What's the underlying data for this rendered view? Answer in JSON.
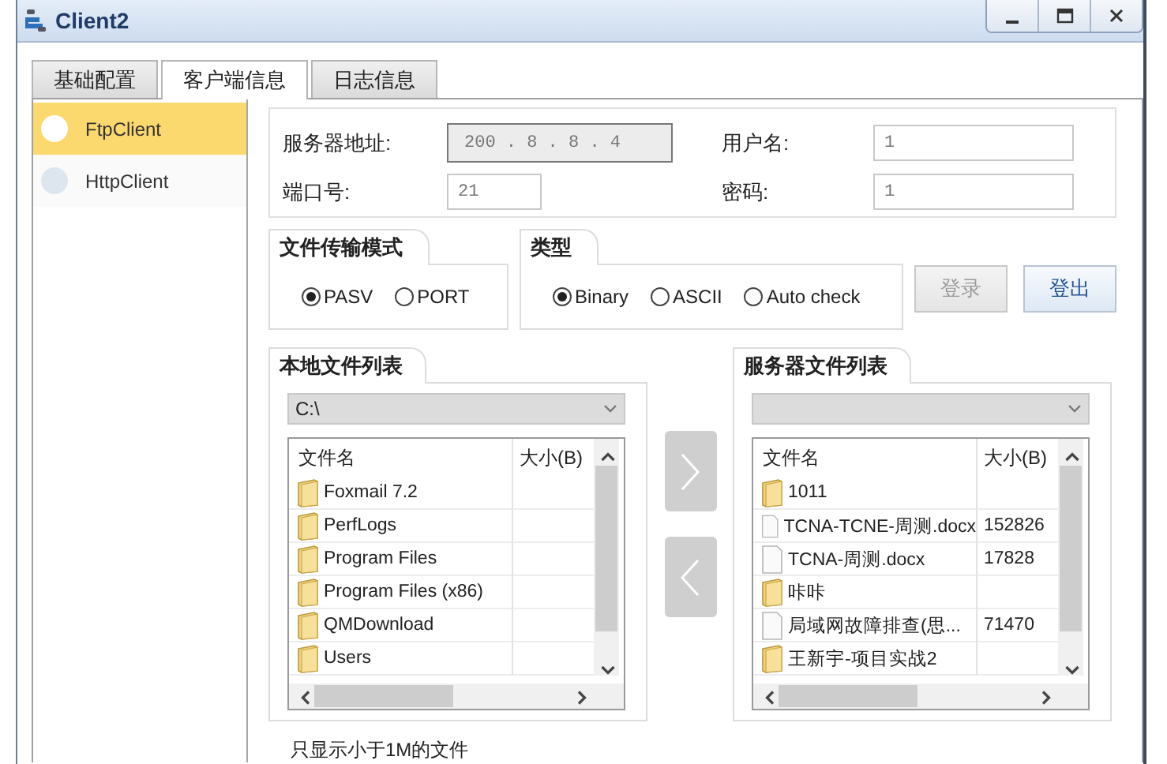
{
  "window": {
    "title": "Client2"
  },
  "tabs": [
    {
      "label": "基础配置",
      "selected": false
    },
    {
      "label": "客户端信息",
      "selected": true
    },
    {
      "label": "日志信息",
      "selected": false
    }
  ],
  "sidebar": {
    "items": [
      {
        "label": "FtpClient",
        "selected": true
      },
      {
        "label": "HttpClient",
        "selected": false
      }
    ]
  },
  "connection": {
    "server_address": {
      "label": "服务器地址:",
      "value": "200 . 8 . 8 . 4"
    },
    "username": {
      "label": "用户名:",
      "value": "1"
    },
    "port": {
      "label": "端口号:",
      "value": "21"
    },
    "password": {
      "label": "密码:",
      "value": "1"
    }
  },
  "transfer_mode": {
    "title": "文件传输模式",
    "options": [
      {
        "label": "PASV",
        "selected": true
      },
      {
        "label": "PORT",
        "selected": false
      }
    ]
  },
  "type": {
    "title": "类型",
    "options": [
      {
        "label": "Binary",
        "selected": true
      },
      {
        "label": "ASCII",
        "selected": false
      },
      {
        "label": "Auto check",
        "selected": false
      }
    ]
  },
  "buttons": [
    {
      "label": "登录",
      "disabled": true
    },
    {
      "label": "登出",
      "disabled": false
    }
  ],
  "local_files": {
    "title": "本地文件列表",
    "path": "C:\\",
    "columns": [
      "文件名",
      "大小(B)"
    ],
    "rows": [
      {
        "kind": "folder",
        "name": "Foxmail 7.2"
      },
      {
        "kind": "folder",
        "name": "PerfLogs"
      },
      {
        "kind": "folder",
        "name": "Program Files"
      },
      {
        "kind": "folder",
        "name": "Program Files (x86)"
      },
      {
        "kind": "folder",
        "name": "QMDownload"
      },
      {
        "kind": "folder",
        "name": "Users"
      }
    ]
  },
  "server_files": {
    "title": "服务器文件列表",
    "columns": [
      "文件名",
      "大小(B)"
    ],
    "rows": [
      {
        "kind": "folder",
        "name": "1011"
      },
      {
        "kind": "file",
        "name": "TCNA-TCNE-周测.docx",
        "size": "152826"
      },
      {
        "kind": "file",
        "name": "TCNA-周测.docx",
        "size": "17828"
      },
      {
        "kind": "folder",
        "name": "咔咔"
      },
      {
        "kind": "file",
        "name": "局域网故障排查(思...",
        "size": "71470"
      },
      {
        "kind": "folder",
        "name": "王新宇-项目实战2"
      }
    ]
  },
  "note": "只显示小于1M的文件"
}
